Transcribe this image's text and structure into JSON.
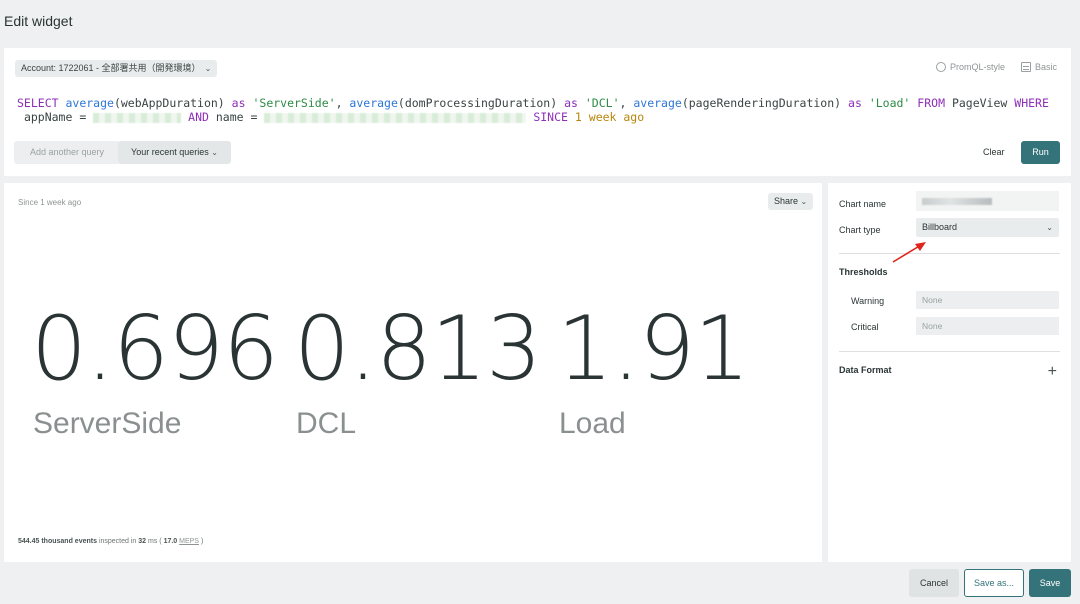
{
  "header": {
    "title": "Edit widget"
  },
  "query": {
    "account_label": "Account: 1722061 - 全部署共用（開発環境）",
    "modes": [
      {
        "label": "PromQL-style",
        "icon": "promql-icon"
      },
      {
        "label": "Basic",
        "icon": "basic-icon"
      }
    ],
    "nrql": {
      "select": "SELECT",
      "fn1": "average",
      "arg1": "(webAppDuration)",
      "as": "as",
      "alias1": "'ServerSide'",
      "fn2": "average",
      "arg2": "(domProcessingDuration)",
      "alias2": "'DCL'",
      "fn3": "average",
      "arg3": "(pageRenderingDuration)",
      "alias3": "'Load'",
      "from": "FROM",
      "table": "PageView",
      "where": "WHERE",
      "field1": "appName",
      "eq": "=",
      "and": "AND",
      "field2": "name",
      "since": "SINCE",
      "since_value": "1",
      "since_unit": "week ago"
    },
    "add_query_label": "Add another query",
    "recent_queries_label": "Your recent queries",
    "clear_label": "Clear",
    "run_label": "Run"
  },
  "chart": {
    "since_label": "Since 1 week ago",
    "share_label": "Share",
    "metrics": [
      {
        "value": "0.696",
        "label": "ServerSide"
      },
      {
        "value": "0.813",
        "label": "DCL"
      },
      {
        "value": "1.91",
        "label": "Load"
      }
    ],
    "stats": {
      "events": "544.45 thousand events",
      "inspected_in": "inspected in",
      "duration": "32",
      "ms_open": "ms (",
      "rate": "17.0",
      "rate_unit": "MEPS",
      "close": ")"
    }
  },
  "settings": {
    "chart_name_label": "Chart name",
    "chart_type_label": "Chart type",
    "chart_type_value": "Billboard",
    "thresholds_title": "Thresholds",
    "warning_label": "Warning",
    "warning_placeholder": "None",
    "critical_label": "Critical",
    "critical_placeholder": "None",
    "data_format_title": "Data Format"
  },
  "footer": {
    "cancel_label": "Cancel",
    "save_as_label": "Save as...",
    "save_label": "Save"
  },
  "colors": {
    "primary": "#35737a",
    "keyword": "#8e2fb7",
    "function": "#2d77d8",
    "string": "#2e8b46",
    "annotation_arrow": "#e0241b"
  }
}
